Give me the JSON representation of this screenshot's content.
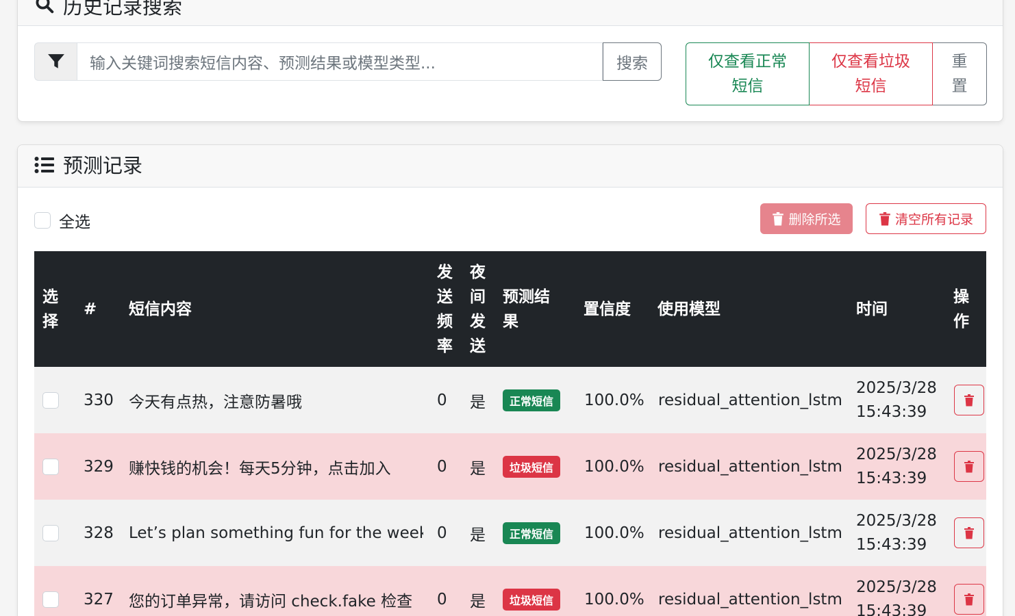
{
  "search_card": {
    "title": "历史记录搜索",
    "placeholder": "输入关键词搜索短信内容、预测结果或模型类型...",
    "search_button": "搜索",
    "filter_normal": "仅查看正常短信",
    "filter_spam": "仅查看垃圾短信",
    "reset": "重置"
  },
  "records_card": {
    "title": "预测记录",
    "select_all": "全选",
    "delete_selected": "删除所选",
    "clear_all": "清空所有记录"
  },
  "table": {
    "headers": {
      "select": "选择",
      "id": "#",
      "content": "短信内容",
      "frequency": "发送频率",
      "night": "夜间发送",
      "result": "预测结果",
      "confidence": "置信度",
      "model": "使用模型",
      "time": "时间",
      "action": "操作"
    },
    "rows": [
      {
        "id": "330",
        "content": "今天有点热，注意防暑哦",
        "frequency": "0",
        "night": "是",
        "result": "正常短信",
        "confidence": "100.0%",
        "model": "residual_attention_lstm",
        "date": "2025/3/28",
        "clock": "15:43:39"
      },
      {
        "id": "329",
        "content": "赚快钱的机会！每天5分钟，点击加入",
        "frequency": "0",
        "night": "是",
        "result": "垃圾短信",
        "confidence": "100.0%",
        "model": "residual_attention_lstm",
        "date": "2025/3/28",
        "clock": "15:43:39"
      },
      {
        "id": "328",
        "content": "Let’s plan something fun for the weekend",
        "frequency": "0",
        "night": "是",
        "result": "正常短信",
        "confidence": "100.0%",
        "model": "residual_attention_lstm",
        "date": "2025/3/28",
        "clock": "15:43:39"
      },
      {
        "id": "327",
        "content": "您的订单异常，请访问 check.fake 检查",
        "frequency": "0",
        "night": "是",
        "result": "垃圾短信",
        "confidence": "100.0%",
        "model": "residual_attention_lstm",
        "date": "2025/3/28",
        "clock": "15:43:39"
      }
    ]
  },
  "colors": {
    "normal": "#198754",
    "spam": "#dc3545",
    "header_bg": "#212529"
  }
}
